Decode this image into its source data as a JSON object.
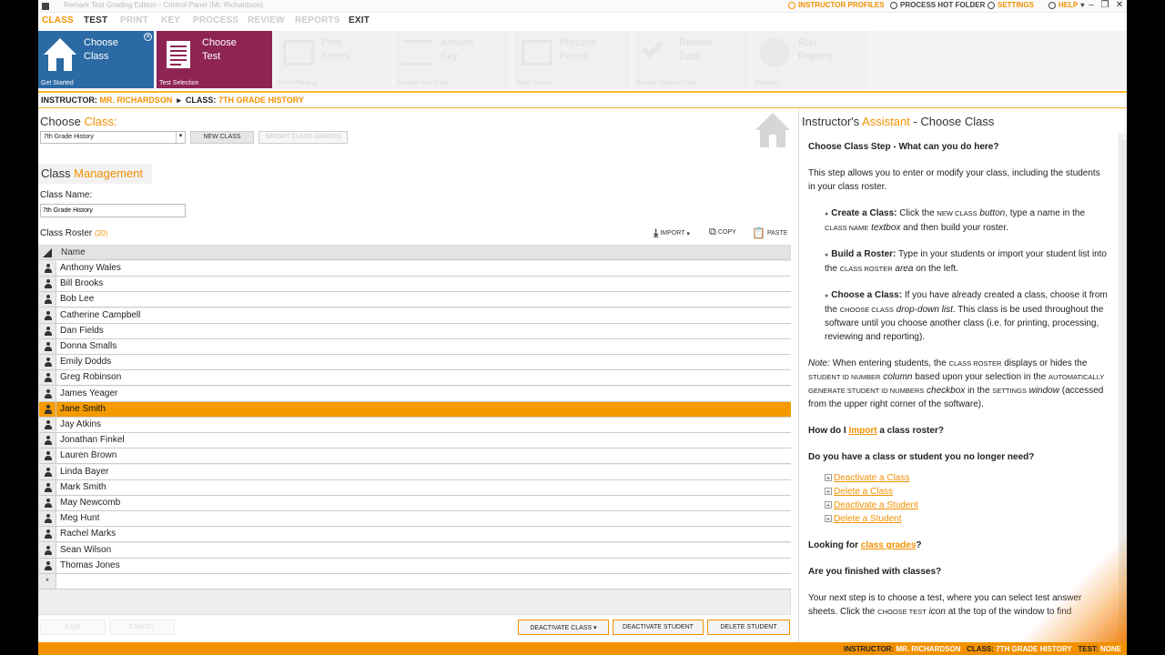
{
  "window": {
    "title": "Remark Test Grading Edition - Control Panel (Mr. Richardson)"
  },
  "menu": [
    "CLASS",
    "TEST",
    "PRINT",
    "KEY",
    "PROCESS",
    "REVIEW",
    "REPORTS",
    "EXIT"
  ],
  "top_links": {
    "instructor_profiles": "INSTRUCTOR PROFILES",
    "process_hot_folder": "PROCESS HOT FOLDER",
    "settings": "SETTINGS",
    "help": "HELP"
  },
  "ribbon": [
    {
      "label1": "Choose",
      "label2": "Class",
      "sub": "Get Started",
      "icon": "house-icon"
    },
    {
      "label1": "Choose",
      "label2": "Test",
      "sub": "Test Selection",
      "icon": "document-icon"
    },
    {
      "label1": "Print",
      "label2": "Forms",
      "sub": "Form Printing",
      "icon": "printer-icon"
    },
    {
      "label1": "Answer",
      "label2": "Key",
      "sub": "Answer Key Entry",
      "icon": "key-icon"
    },
    {
      "label1": "Process",
      "label2": "Forms",
      "sub": "Scan Forms",
      "icon": "scan-icon"
    },
    {
      "label1": "Review",
      "label2": "Data",
      "sub": "Review Student Data",
      "icon": "check-icon"
    },
    {
      "label1": "Run",
      "label2": "Reports",
      "sub": "Analysis",
      "icon": "pie-icon"
    }
  ],
  "breadcrumb": {
    "instructor_key": "INSTRUCTOR:",
    "instructor_val": "MR. RICHARDSON",
    "class_key": "CLASS:",
    "class_val": "7TH GRADE HISTORY"
  },
  "left": {
    "choose_label": "Choose",
    "choose_label_accent": "Class:",
    "class_select": "7th Grade History",
    "new_class": "NEW CLASS",
    "import_grades": "IMPORT CLASS GRADES",
    "section_a": "Class",
    "section_b": "Management",
    "class_name_label": "Class Name:",
    "class_name_value": "7th Grade History",
    "roster_label": "Class Roster",
    "roster_count": "(20)",
    "import": "IMPORT",
    "copy": "COPY",
    "paste": "PASTE",
    "col_name": "Name",
    "new_row_marker": "*",
    "students": [
      "Anthony Wales",
      "Bill Brooks",
      "Bob Lee",
      "Catherine Campbell",
      "Dan Fields",
      "Donna Smalls",
      "Emily Dodds",
      "Greg Robinson",
      "James Yeager",
      "Jane Smith",
      "Jay Atkins",
      "Jonathan Finkel",
      "Lauren Brown",
      "Linda Bayer",
      "Mark Smith",
      "May Newcomb",
      "Meg Hunt",
      "Rachel Marks",
      "Sean Wilson",
      "Thomas Jones"
    ],
    "selected_student": "Jane Smith",
    "save": "SAVE",
    "cancel": "CANCEL",
    "deactivate_class": "DEACTIVATE CLASS",
    "deactivate_student": "DEACTIVATE STUDENT",
    "delete_student": "DELETE STUDENT"
  },
  "assistant": {
    "title_a": "Instructor's",
    "title_b": "Assistant",
    "title_c": "- Choose Class",
    "step_heading": "Choose Class Step - What can you do here?",
    "intro": "This step allows you to enter or modify your class, including the students in your class roster.",
    "create_h": "Create a Class:",
    "create_t1": "Click the",
    "create_sc1": "NEW CLASS",
    "create_em1": "button",
    "create_t2": ", type a name in the",
    "create_sc2": "CLASS NAME",
    "create_em2": "textbox",
    "create_t3": "and then build your roster.",
    "build_h": "Build a Roster:",
    "build_t1": "Type in your students or import your student list into the",
    "build_sc": "CLASS ROSTER",
    "build_em": "area",
    "build_t2": "on the left.",
    "choose_h": "Choose a Class:",
    "choose_t1": "If you have already created a class, choose it from the",
    "choose_sc": "CHOOSE CLASS",
    "choose_em": "drop-down list",
    "choose_t2": ". This class is be used throughout the software until you choose another class (i.e. for printing, processing, reviewing and reporting).",
    "note_label": "Note:",
    "note_t1": "When entering students, the",
    "note_sc1": "CLASS ROSTER",
    "note_t2": "displays or hides the",
    "note_sc2": "STUDENT ID NUMBER",
    "note_em1": "column",
    "note_t3": "based upon your selection in the",
    "note_sc3": "AUTOMATICALLY GENERATE STUDENT ID NUMBERS",
    "note_em2": "checkbox",
    "note_t4": "in the",
    "note_sc4": "SETTINGS",
    "note_em3": "window",
    "note_t5": "(accessed from the upper right corner of the software).",
    "import_q_a": "How do I",
    "import_q_link": "Import",
    "import_q_b": "a class roster?",
    "nolonger_q": "Do you have a class or student you no longer need?",
    "links": [
      "Deactivate a Class",
      "Delete a Class",
      "Deactivate a Student",
      "Delete a Student"
    ],
    "grades_a": "Looking for",
    "grades_link": "class grades",
    "grades_b": "?",
    "finished_q": "Are you finished with classes?",
    "next_t1": "Your next step is to choose a test, where you can select test answer sheets. Click the",
    "next_sc": "CHOOSE TEST",
    "next_em": "icon",
    "next_t2": "at the top of the window to find"
  },
  "status": {
    "instructor_key": "INSTRUCTOR:",
    "instructor_val": "MR. RICHARDSON",
    "class_key": "CLASS:",
    "class_val": "7TH GRADE HISTORY",
    "test_key": "TEST:",
    "test_val": "NONE"
  },
  "colors": {
    "accent": "#f29100",
    "class_tile": "#2b6aa4",
    "test_tile": "#8e2454",
    "selected_row": "#f59b00"
  }
}
